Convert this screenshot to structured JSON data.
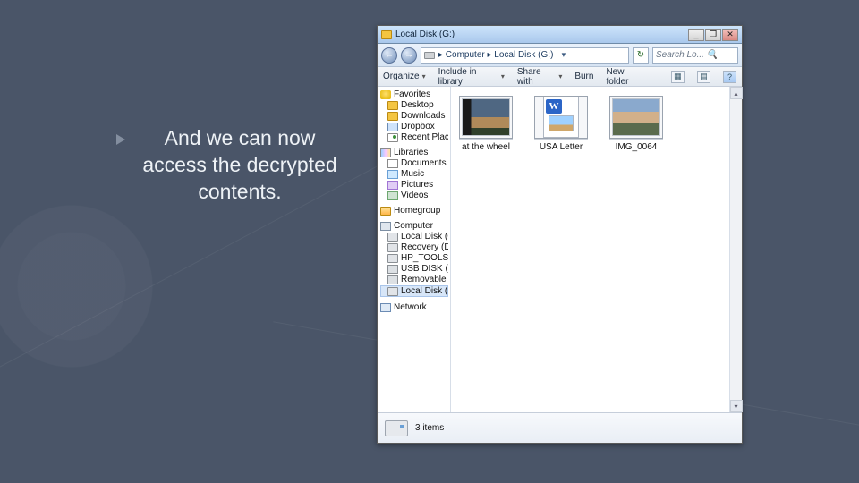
{
  "slide": {
    "caption": "And we can now access the decrypted contents."
  },
  "window": {
    "title": "Local Disk (G:)",
    "win_buttons": {
      "min": "_",
      "max": "❐",
      "close": "✕"
    },
    "nav": {
      "back": "←",
      "fwd": "→"
    },
    "breadcrumb": "▸ Computer ▸ Local Disk (G:)",
    "breadcrumb_dropdown": "▾",
    "refresh": "↻",
    "search_placeholder": "Search Lo...",
    "search_icon": "🔍"
  },
  "toolbar": {
    "items": [
      {
        "label": "Organize",
        "has_menu": true
      },
      {
        "label": "Include in library",
        "has_menu": true
      },
      {
        "label": "Share with",
        "has_menu": true
      },
      {
        "label": "Burn",
        "has_menu": false
      },
      {
        "label": "New folder",
        "has_menu": false
      }
    ],
    "view_icons": {
      "thumbs": "▦",
      "preview": "▤",
      "help": "?"
    }
  },
  "navpane": {
    "favorites": {
      "label": "Favorites",
      "items": [
        "Desktop",
        "Downloads",
        "Dropbox",
        "Recent Places"
      ]
    },
    "libraries": {
      "label": "Libraries",
      "items": [
        "Documents",
        "Music",
        "Pictures",
        "Videos"
      ]
    },
    "homegroup": {
      "label": "Homegroup"
    },
    "computer": {
      "label": "Computer",
      "items": [
        "Local Disk (C:)",
        "Recovery (D:)",
        "HP_TOOLS (E:)",
        "USB DISK (G:)",
        "Removable Di...",
        "Local Disk (G:)"
      ],
      "selected_index": 5
    },
    "network": {
      "label": "Network"
    }
  },
  "files": [
    {
      "name": "at the wheel",
      "kind": "image"
    },
    {
      "name": "USA Letter",
      "kind": "word"
    },
    {
      "name": "IMG_0064",
      "kind": "image-dark"
    }
  ],
  "statusbar": {
    "text": "3 items"
  }
}
